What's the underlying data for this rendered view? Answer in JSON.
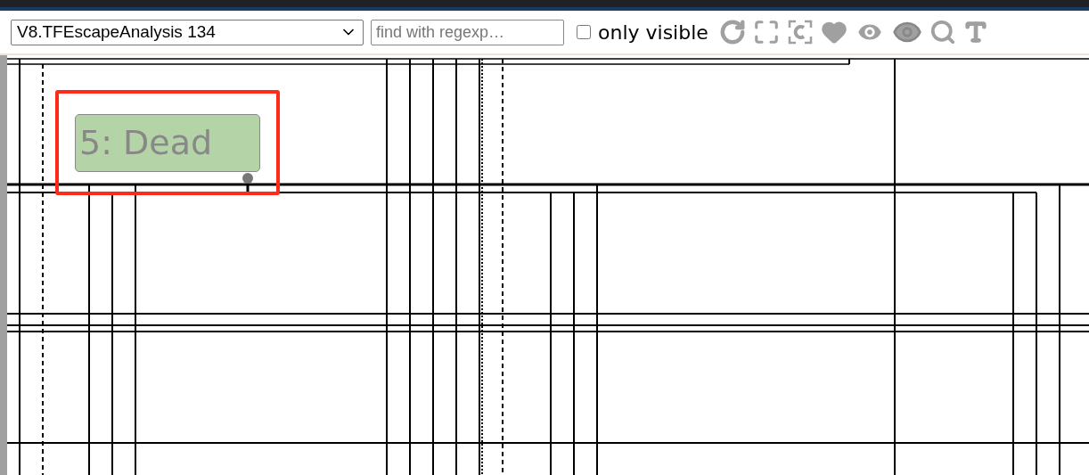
{
  "toolbar": {
    "graph_select": "V8.TFEscapeAnalysis 134",
    "search": {
      "placeholder": "find with regexp…"
    },
    "only_visible": {
      "label": "only visible",
      "checked": false
    }
  },
  "graph": {
    "nodes": [
      {
        "label": "5: Dead",
        "highlighted": true
      }
    ]
  }
}
